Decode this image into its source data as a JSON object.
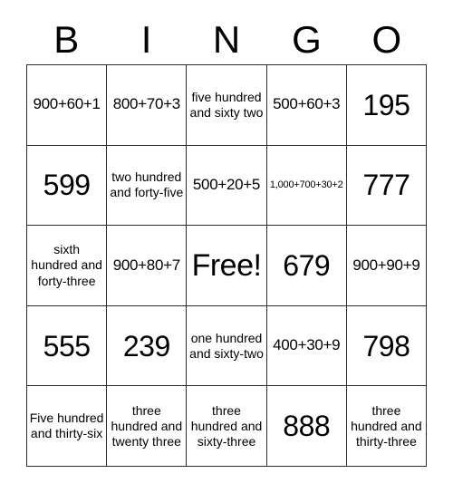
{
  "card": {
    "title_letters": [
      "B",
      "I",
      "N",
      "G",
      "O"
    ],
    "free_space_label": "Free!",
    "grid": [
      [
        {
          "text": "900+60+1",
          "size": "md"
        },
        {
          "text": "800+70+3",
          "size": "md"
        },
        {
          "text": "five hundred and sixty two",
          "size": "xs"
        },
        {
          "text": "500+60+3",
          "size": "md"
        },
        {
          "text": "195",
          "size": "lg"
        }
      ],
      [
        {
          "text": "599",
          "size": "lg"
        },
        {
          "text": "two hundred and forty-five",
          "size": "xs"
        },
        {
          "text": "500+20+5",
          "size": "md"
        },
        {
          "text": "1,000+700+30+2",
          "size": "xxs"
        },
        {
          "text": "777",
          "size": "lg"
        }
      ],
      [
        {
          "text": "sixth hundred and forty-three",
          "size": "xs"
        },
        {
          "text": "900+80+7",
          "size": "md"
        },
        {
          "text": "Free!",
          "size": "xl"
        },
        {
          "text": "679",
          "size": "lg"
        },
        {
          "text": "900+90+9",
          "size": "md"
        }
      ],
      [
        {
          "text": "555",
          "size": "lg"
        },
        {
          "text": "239",
          "size": "lg"
        },
        {
          "text": "one hundred and sixty-two",
          "size": "xs"
        },
        {
          "text": "400+30+9",
          "size": "md"
        },
        {
          "text": "798",
          "size": "lg"
        }
      ],
      [
        {
          "text": "Five hundred and thirty-six",
          "size": "xs"
        },
        {
          "text": "three hundred and twenty three",
          "size": "xs"
        },
        {
          "text": "three hundred and sixty-three",
          "size": "xs"
        },
        {
          "text": "888",
          "size": "lg"
        },
        {
          "text": "three hundred and thirty-three",
          "size": "xs"
        }
      ]
    ]
  },
  "colors": {
    "grid_line": "#2b2b2b",
    "text": "#000000",
    "background": "#ffffff"
  }
}
